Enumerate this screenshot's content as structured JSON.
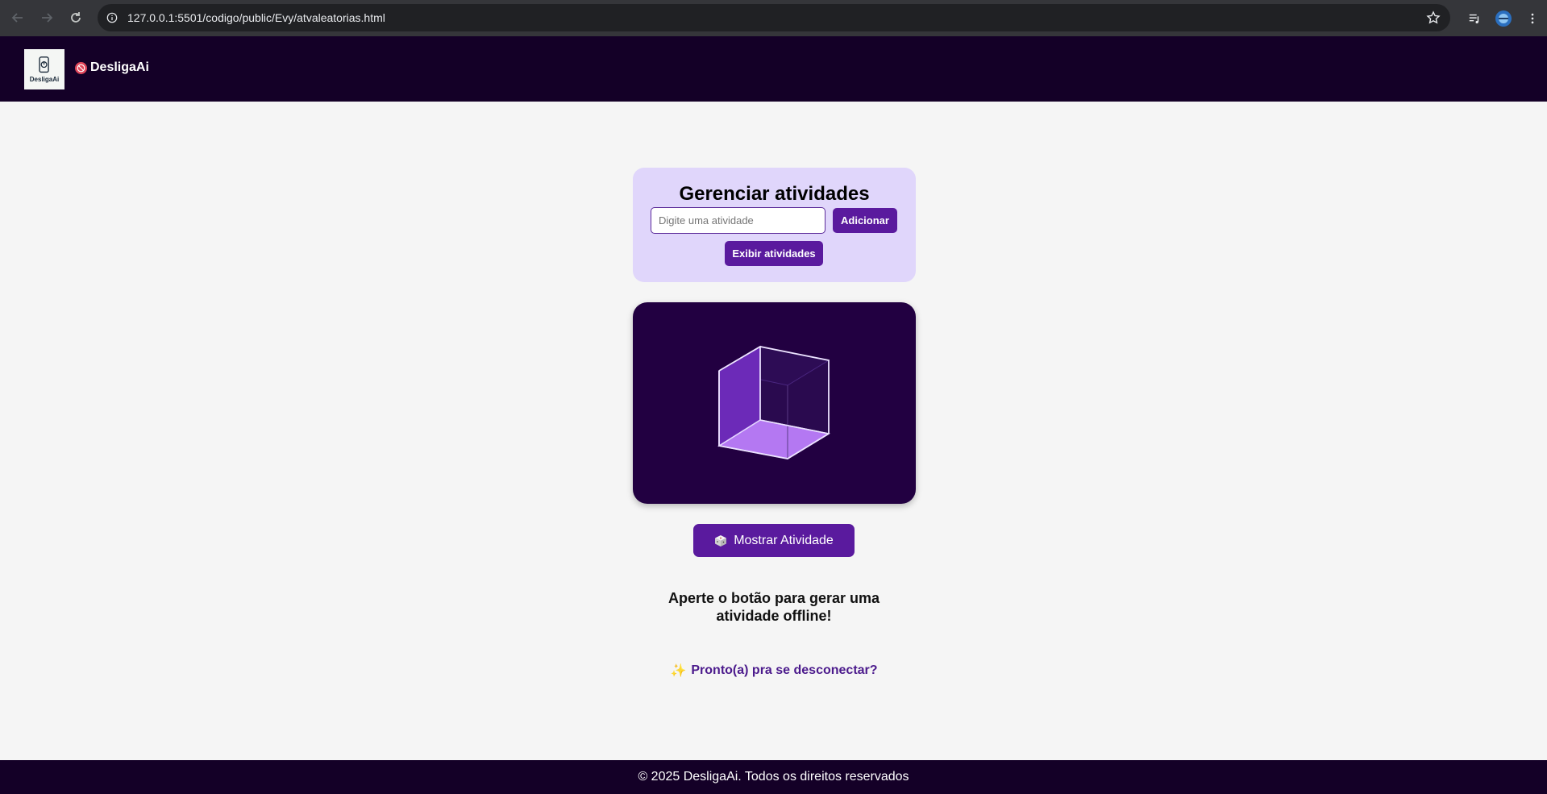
{
  "browser": {
    "url": "127.0.0.1:5501/codigo/public/Evy/atvaleatorias.html"
  },
  "header": {
    "logo_text": "DesligaAi",
    "brand_name": "DesligaAi"
  },
  "manager": {
    "title": "Gerenciar atividades",
    "input_placeholder": "Digite uma atividade",
    "input_value": "",
    "add_label": "Adicionar",
    "show_list_label": "Exibir atividades"
  },
  "main": {
    "roll_button_label": "Mostrar Atividade",
    "result_text": "Aperte o botão para gerar uma atividade offline!",
    "ready_text": "Pronto(a) pra se desconectar?"
  },
  "footer": {
    "text": "© 2025 DesligaAi. Todos os direitos reservados"
  },
  "colors": {
    "header_bg": "#140027",
    "accent": "#5a1a9e",
    "card_bg": "#e0d6fb",
    "cube_panel_bg": "#220041"
  }
}
